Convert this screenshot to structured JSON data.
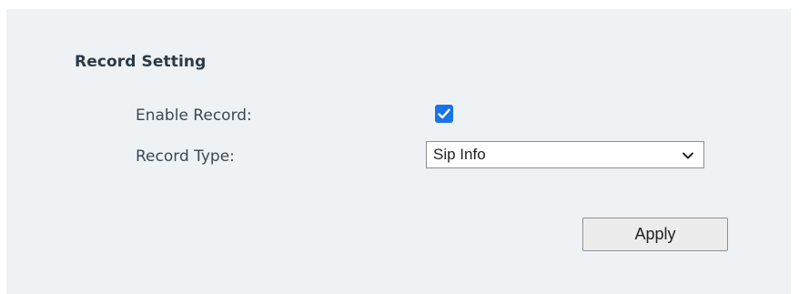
{
  "section": {
    "title": "Record Setting"
  },
  "fields": {
    "enable_record": {
      "label": "Enable Record:",
      "checked": true
    },
    "record_type": {
      "label": "Record Type:",
      "value": "Sip Info"
    }
  },
  "actions": {
    "apply_label": "Apply"
  },
  "colors": {
    "panel_background": "#eef2f5",
    "checkbox_accent": "#1a73e8"
  },
  "icons": {
    "checkbox_mark": "checkmark-icon",
    "select_arrow": "chevron-down-icon"
  }
}
